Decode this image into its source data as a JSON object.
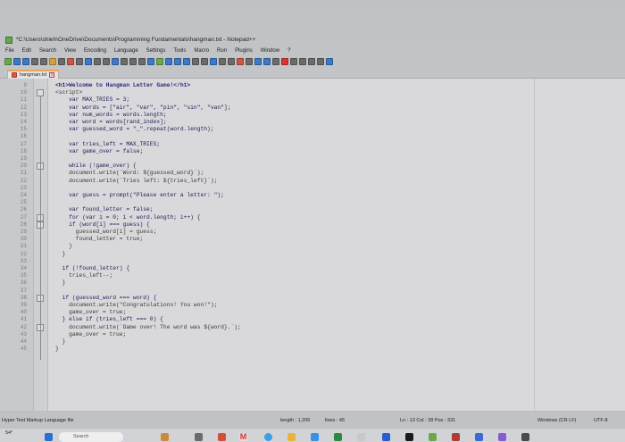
{
  "window": {
    "title": "*C:\\Users\\shieh\\OneDrive\\Documents\\Programming Fundamentals\\hangman.txt - Notepad++"
  },
  "menu": [
    "File",
    "Edit",
    "Search",
    "View",
    "Encoding",
    "Language",
    "Settings",
    "Tools",
    "Macro",
    "Run",
    "Plugins",
    "Window",
    "?"
  ],
  "tab": {
    "label": "hangman.txt",
    "close": "x"
  },
  "editor": {
    "lines": [
      {
        "n": "9",
        "t": "<h1>Welcome to Hangman Letter Game!</h1>"
      },
      {
        "n": "10",
        "t": "<script>"
      },
      {
        "n": "11",
        "t": "    var MAX_TRIES = 3;"
      },
      {
        "n": "12",
        "t": "    var words = [\"air\", \"var\", \"pin\", \"sin\", \"van\"];"
      },
      {
        "n": "13",
        "t": "    var num_words = words.length;"
      },
      {
        "n": "14",
        "t": "    var word = words[rand_index];"
      },
      {
        "n": "15",
        "t": "    var guessed_word = \"_\".repeat(word.length);"
      },
      {
        "n": "16",
        "t": ""
      },
      {
        "n": "17",
        "t": "    var tries_left = MAX_TRIES;"
      },
      {
        "n": "18",
        "t": "    var game_over = false;"
      },
      {
        "n": "19",
        "t": ""
      },
      {
        "n": "20",
        "t": "    while (!game_over) {"
      },
      {
        "n": "21",
        "t": "    document.write(`Word: ${guessed_word}`);"
      },
      {
        "n": "22",
        "t": "    document.write(`Tries left: ${tries_left}`);"
      },
      {
        "n": "23",
        "t": ""
      },
      {
        "n": "24",
        "t": "    var guess = prompt(\"Please enter a letter: \");"
      },
      {
        "n": "25",
        "t": ""
      },
      {
        "n": "26",
        "t": "    var found_letter = false;"
      },
      {
        "n": "27",
        "t": "    for (var i = 0; i < word.length; i++) {"
      },
      {
        "n": "28",
        "t": "    if (word[i] === guess) {"
      },
      {
        "n": "29",
        "t": "      guessed_word[i] = guess;"
      },
      {
        "n": "30",
        "t": "      found_letter = true;"
      },
      {
        "n": "31",
        "t": "    }"
      },
      {
        "n": "32",
        "t": "  }"
      },
      {
        "n": "33",
        "t": ""
      },
      {
        "n": "34",
        "t": "  if (!found_letter) {"
      },
      {
        "n": "35",
        "t": "    tries_left--;"
      },
      {
        "n": "36",
        "t": "  }"
      },
      {
        "n": "37",
        "t": ""
      },
      {
        "n": "38",
        "t": "  if (guessed_word === word) {"
      },
      {
        "n": "39",
        "t": "    document.write(\"Congratulations! You won!\");"
      },
      {
        "n": "40",
        "t": "    game_over = true;"
      },
      {
        "n": "41",
        "t": "  } else if (tries_left === 0) {"
      },
      {
        "n": "42",
        "t": "    document.write(`Game over! The word was ${word}.`);"
      },
      {
        "n": "43",
        "t": "    game_over = true;"
      },
      {
        "n": "44",
        "t": "  }"
      },
      {
        "n": "45",
        "t": "}"
      }
    ]
  },
  "statusbar": {
    "language": "Hyper Text Markup Language file",
    "length": "length : 1,206",
    "lines": "lines : 45",
    "position": "Ln : 13    Col : 38    Pos : 331",
    "eol": "Windows (CR LF)",
    "encoding": "UTF-8"
  },
  "taskbar": {
    "temperature": "54°",
    "search_placeholder": "Search"
  }
}
